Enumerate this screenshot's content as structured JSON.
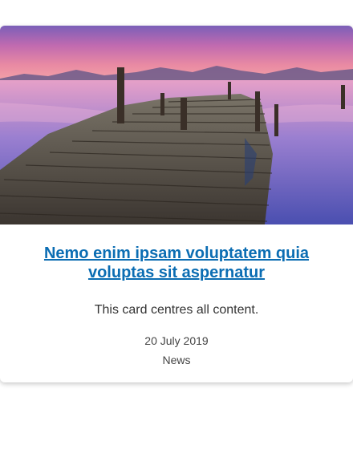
{
  "card": {
    "image_alt": "Wooden pier stretching over a calm lake at dusk",
    "title": "Nemo enim ipsam voluptatem quia voluptas sit aspernatur",
    "description": "This card centres all content.",
    "date": "20 July 2019",
    "category": "News"
  },
  "colors": {
    "link": "#0b6db3",
    "text": "#333333",
    "background": "#ffffff"
  }
}
